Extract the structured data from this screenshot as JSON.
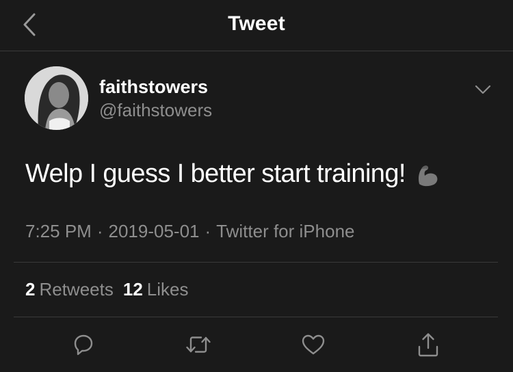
{
  "nav": {
    "title": "Tweet",
    "back_icon": "chevron-left-icon"
  },
  "author": {
    "display_name": "faithstowers",
    "handle": "@faithstowers",
    "avatar_icon": "profile-photo"
  },
  "tweet": {
    "text": "Welp I guess I better start training!",
    "emoji_icon": "flexed-biceps-emoji"
  },
  "meta": {
    "time": "7:25 PM",
    "separator": "·",
    "date": "2019-05-01",
    "source": "Twitter for iPhone"
  },
  "stats": {
    "retweets_count": "2",
    "retweets_label": "Retweets",
    "likes_count": "12",
    "likes_label": "Likes"
  },
  "actions": {
    "reply_icon": "reply-icon",
    "retweet_icon": "retweet-icon",
    "like_icon": "heart-icon",
    "share_icon": "share-icon"
  },
  "colors": {
    "background": "#1a1a1a",
    "primary_text": "#ffffff",
    "secondary_text": "#8e8e8e",
    "divider": "#3a3a3a"
  }
}
